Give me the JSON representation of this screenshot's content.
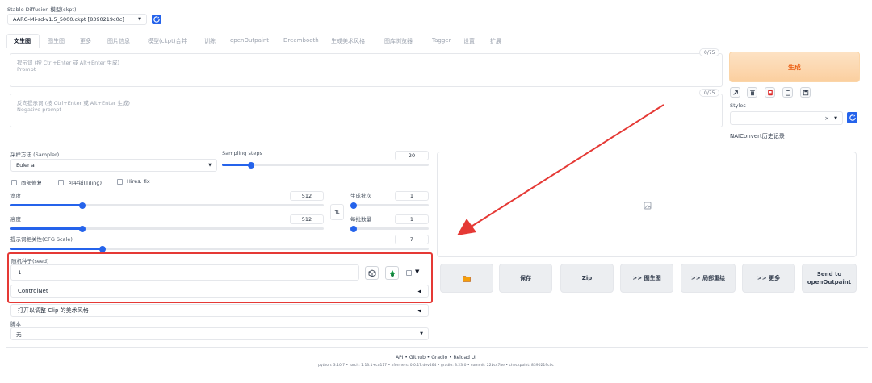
{
  "model": {
    "label": "Stable Diffusion 模型(ckpt)",
    "value": "AARG-Mi-sd-v1.5_5000.ckpt [8390219c0c]"
  },
  "tabs": [
    "文生图",
    "图生图",
    "更多",
    "图片信息",
    "模型(ckpt)合并",
    "训练",
    "openOutpaint",
    "Dreambooth",
    "生成美术风格",
    "图库浏览器",
    "Tagger",
    "设置",
    "扩展"
  ],
  "prompt": {
    "placeholder": "提示词 (按 Ctrl+Enter 或 Alt+Enter 生成)",
    "sub": "Prompt",
    "counter": "0/75"
  },
  "negative": {
    "placeholder": "反向提示词 (按 Ctrl+Enter 或 Alt+Enter 生成)",
    "sub": "Negative prompt",
    "counter": "0/75"
  },
  "generate_label": "生成",
  "styles_label": "Styles",
  "styles_clear": "×",
  "nai_history": "NAIConvert历史记录",
  "sampler": {
    "label": "采样方法 (Sampler)",
    "value": "Euler a"
  },
  "steps": {
    "label": "Sampling steps",
    "value": "20",
    "fraction": 0.14
  },
  "checks": [
    "面部修复",
    "可平铺(Tiling)",
    "Hires. fix"
  ],
  "width": {
    "label": "宽度",
    "value": "512",
    "fraction": 0.23
  },
  "height": {
    "label": "高度",
    "value": "512",
    "fraction": 0.23
  },
  "swap_label": "⇅",
  "batch_count": {
    "label": "生成批次",
    "value": "1",
    "fraction": 0.0
  },
  "batch_size": {
    "label": "每批数量",
    "value": "1",
    "fraction": 0.0
  },
  "cfg": {
    "label": "提示词相关性(CFG Scale)",
    "value": "7",
    "fraction": 0.22
  },
  "seed": {
    "label": "随机种子(seed)",
    "value": "-1"
  },
  "controlnet": "ControlNet",
  "clip_style": "打开以调整 Clip 的美术风格！",
  "script": {
    "label": "脚本",
    "value": "无"
  },
  "actions": {
    "save": "保存",
    "zip": "Zip",
    "img2img": ">> 图生图",
    "inpaint": ">> 局部重绘",
    "extras": ">> 更多",
    "outpaint_line1": "Send to",
    "outpaint_line2": "openOutpaint"
  },
  "footer": {
    "links": "API • Github • Gradio • Reload UI",
    "versions": "python: 3.10.7  •  torch: 1.13.1+cu117  •  xformers: 0.0.17.dev464  •  gradio: 3.23.0  •  commit: 22bcc7be  •  checkpoint: 8390219c0c"
  },
  "colors": {
    "accent": "#2563eb",
    "highlight_box": "#e53935",
    "arrow": "#e53935",
    "generate_bg": "#fcd9b3",
    "generate_text": "#ea580c"
  }
}
